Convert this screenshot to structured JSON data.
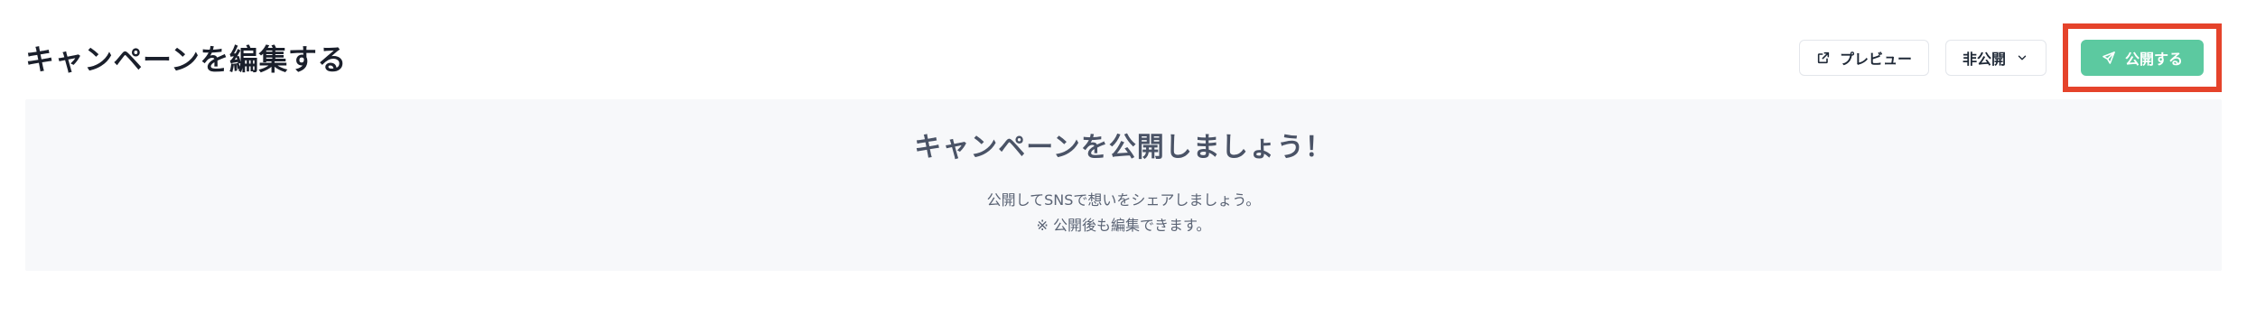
{
  "header": {
    "title": "キャンペーンを編集する",
    "preview_label": "プレビュー",
    "preview_icon": "external-link-icon",
    "visibility_label": "非公開",
    "visibility_icon": "chevron-down-icon",
    "publish_label": "公開する",
    "publish_icon": "send-icon"
  },
  "panel": {
    "heading": "キャンペーンを公開しましょう！",
    "line1": "公開してSNSで想いをシェアしましょう。",
    "line2": "※ 公開後も編集できます。"
  },
  "colors": {
    "accent": "#5cc9a0",
    "highlight": "#e5432b",
    "panel_bg": "#f7f8fa"
  }
}
